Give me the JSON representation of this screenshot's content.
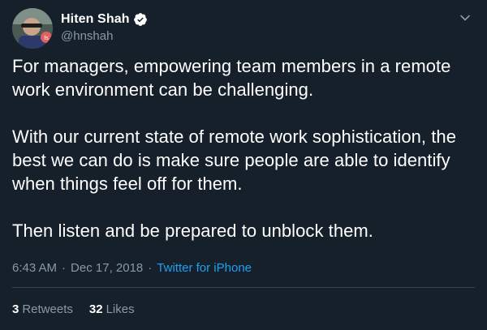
{
  "author": {
    "name": "Hiten Shah",
    "handle": "@hnshah",
    "verified": true
  },
  "tweet": {
    "paragraphs": [
      "For managers, empowering team members in a remote work environment can be challenging.",
      "With our current state of remote work sophistication, the best we can do is make sure people are able to identify when things feel off for them.",
      "Then listen and be prepared to unblock them."
    ],
    "time": "6:43 AM",
    "separator": "·",
    "date": "Dec 17, 2018",
    "source": "Twitter for iPhone"
  },
  "stats": {
    "retweets_count": "3",
    "retweets_label": "Retweets",
    "likes_count": "32",
    "likes_label": "Likes"
  },
  "icons": {
    "verified": "verified-badge-icon",
    "menu": "chevron-down-icon"
  },
  "colors": {
    "background": "#15202b",
    "text_primary": "#ffffff",
    "text_secondary": "#8899a6",
    "accent": "#1da1f2",
    "divider": "#38444d"
  }
}
